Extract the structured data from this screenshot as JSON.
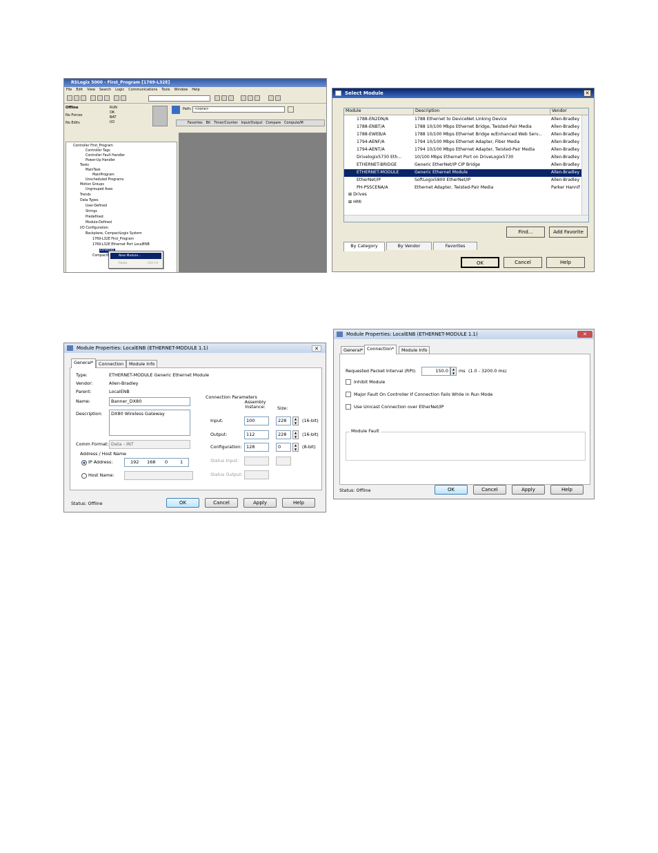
{
  "rslogix": {
    "title": "RSLogix 5000 - First_Program [1769-L32E]",
    "menu": [
      "File",
      "Edit",
      "View",
      "Search",
      "Logic",
      "Communications",
      "Tools",
      "Window",
      "Help"
    ],
    "status": {
      "mode": "Offline",
      "forces": "No Forces",
      "edits": "No Edits",
      "leds": [
        "RUN",
        "OK",
        "BAT",
        "I/O"
      ]
    },
    "path_label": "Path:",
    "path_value": "<none>",
    "tabs": [
      "Favorites",
      "Bit",
      "Timer/Counter",
      "Input/Output",
      "Compare",
      "Compute/M"
    ],
    "tree": [
      "Controller First_Program",
      "Controller Tags",
      "Controller Fault Handler",
      "Power-Up Handler",
      "Tasks",
      "MainTask",
      "MainProgram",
      "Unscheduled Programs",
      "Motion Groups",
      "Ungrouped Axes",
      "Trends",
      "Data Types",
      "User-Defined",
      "Strings",
      "Predefined",
      "Module-Defined",
      "I/O Configuration",
      "Backplane, CompactLogix System",
      "1769-L32E First_Program",
      "1769-L32E Ethernet Port LocalENB",
      "Ethernet",
      "CompactBus Local"
    ],
    "context_menu": {
      "new_module": "New Module...",
      "paste": "Paste",
      "paste_shortcut": "Ctrl+V"
    }
  },
  "select_module": {
    "title": "Select Module",
    "columns": [
      "Module",
      "Description",
      "Vendor"
    ],
    "rows": [
      [
        "1788-EN2DN/A",
        "1788 Ethernet to DeviceNet Linking Device",
        "Allen-Bradley"
      ],
      [
        "1788-ENBT/A",
        "1788 10/100 Mbps Ethernet Bridge, Twisted-Pair Media",
        "Allen-Bradley"
      ],
      [
        "1788-EWEB/A",
        "1788 10/100 Mbps Ethernet Bridge w/Enhanced Web Serv...",
        "Allen-Bradley"
      ],
      [
        "1794-AENF/A",
        "1794 10/100 Mbps Ethernet Adapter, Fiber Media",
        "Allen-Bradley"
      ],
      [
        "1794-AENT/A",
        "1794 10/100 Mbps Ethernet Adapter, Twisted-Pair Media",
        "Allen-Bradley"
      ],
      [
        "Drivelogix5730 Eth...",
        "10/100 Mbps Ethernet Port on DriveLogix5730",
        "Allen-Bradley"
      ],
      [
        "ETHERNET-BRIDGE",
        "Generic EtherNet/IP CIP Bridge",
        "Allen-Bradley"
      ],
      [
        "ETHERNET-MODULE",
        "Generic Ethernet Module",
        "Allen-Bradley"
      ],
      [
        "EtherNet/IP",
        "SoftLogix5800 EtherNet/IP",
        "Allen-Bradley"
      ],
      [
        "PH-PSSCENA/A",
        "Ethernet Adapter, Twisted-Pair Media",
        "Parker Hannif"
      ]
    ],
    "groups": [
      "Drives",
      "HMI"
    ],
    "find": "Find...",
    "add_favorite": "Add Favorite",
    "tabs": [
      "By Category",
      "By Vendor",
      "Favorites"
    ],
    "ok": "OK",
    "cancel": "Cancel",
    "help": "Help"
  },
  "general": {
    "title": "Module Properties: LocalENB (ETHERNET-MODULE 1.1)",
    "tabs": [
      "General*",
      "Connection",
      "Module Info"
    ],
    "type_label": "Type:",
    "type_value": "ETHERNET-MODULE Generic Ethernet Module",
    "vendor_label": "Vendor:",
    "vendor_value": "Allen-Bradley",
    "parent_label": "Parent:",
    "parent_value": "LocalENB",
    "name_label": "Name:",
    "name_value": "Banner_DX80",
    "desc_label": "Description:",
    "desc_value": "DX80 Wireless Gateway",
    "comm_label": "Comm Format:",
    "comm_value": "Data - INT",
    "addr_group": "Address / Host Name",
    "ip_label": "IP Address:",
    "ip": [
      "192",
      "168",
      "0",
      "1"
    ],
    "host_label": "Host Name:",
    "conn_group": "Connection Parameters",
    "assembly_header": "Assembly Instance:",
    "size_header": "Size:",
    "params": [
      {
        "label": "Input:",
        "instance": "100",
        "size": "228",
        "unit": "(16-bit)"
      },
      {
        "label": "Output:",
        "instance": "112",
        "size": "228",
        "unit": "(16-bit)"
      },
      {
        "label": "Configuration:",
        "instance": "128",
        "size": "0",
        "unit": "(8-bit)"
      }
    ],
    "status_input": "Status Input:",
    "status_output": "Status Output:",
    "status": "Status:  Offline",
    "ok": "OK",
    "cancel": "Cancel",
    "apply": "Apply",
    "help": "Help"
  },
  "connection": {
    "title": "Module Properties: LocalENB (ETHERNET-MODULE 1.1)",
    "tabs": [
      "General*",
      "Connection*",
      "Module Info"
    ],
    "rpi_label": "Requested Packet Interval (RPI):",
    "rpi_value": "150.0",
    "rpi_unit": "ms",
    "rpi_range": "(1.0 - 3200.0 ms)",
    "options": [
      "Inhibit Module",
      "Major Fault On Controller If Connection Fails While in Run Mode",
      "Use Unicast Connection over EtherNet/IP"
    ],
    "fault_group": "Module Fault",
    "status": "Status:  Offline",
    "ok": "OK",
    "cancel": "Cancel",
    "apply": "Apply",
    "help": "Help"
  }
}
